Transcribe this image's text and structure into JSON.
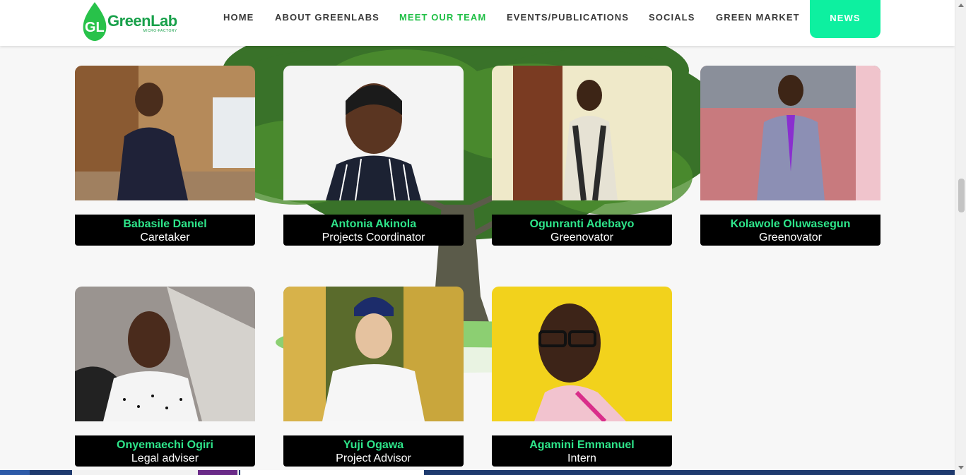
{
  "header": {
    "logo": {
      "name": "GreenLab",
      "sub": "MICRO-FACTORY",
      "mark": "GL"
    },
    "nav": [
      {
        "label": "HOME",
        "active": false
      },
      {
        "label": "ABOUT GREENLABS",
        "active": false
      },
      {
        "label": "MEET OUR TEAM",
        "active": true
      },
      {
        "label": "EVENTS/PUBLICATIONS",
        "active": false
      },
      {
        "label": "SOCIALS",
        "active": false
      },
      {
        "label": "GREEN MARKET",
        "active": false
      }
    ],
    "news_label": "NEWS"
  },
  "team": [
    {
      "name": "Babasile Daniel",
      "role": "Caretaker"
    },
    {
      "name": "Antonia Akinola",
      "role": "Projects Coordinator"
    },
    {
      "name": "Ogunranti Adebayo",
      "role": "Greenovator"
    },
    {
      "name": "Kolawole Oluwasegun",
      "role": "Greenovator"
    },
    {
      "name": "Onyemaechi Ogiri",
      "role": "Legal adviser"
    },
    {
      "name": "Yuji Ogawa",
      "role": "Project Advisor"
    },
    {
      "name": "Agamini Emmanuel",
      "role": "Intern"
    }
  ],
  "colors": {
    "accent_green": "#1fbf45",
    "name_green": "#2ee58a",
    "news_button": "#0df0a0",
    "caption_bg": "#000000"
  }
}
